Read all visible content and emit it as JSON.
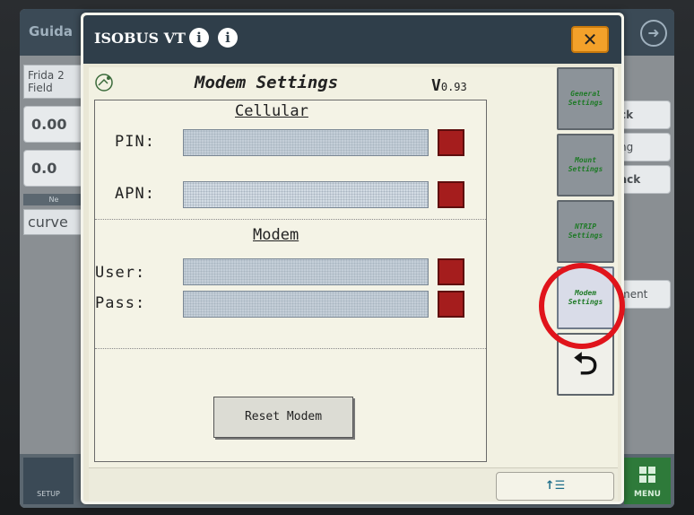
{
  "background": {
    "title": "Guida",
    "left_cards": [
      "Frida 2",
      "Field"
    ],
    "left_values": [
      "0.00",
      "0.0"
    ],
    "left_label": "Ne",
    "curve_text": "curve",
    "right_texts": [
      "ck",
      "ng",
      "ack",
      "ment"
    ],
    "setup_label": "SETUP",
    "menu_label": "MENU"
  },
  "vt": {
    "title": "ISOBUS VT",
    "info_icon_1": "i",
    "info_icon_2": "i",
    "close_label": "✕"
  },
  "mask": {
    "title": "Modem Settings",
    "version_big": "V",
    "version_small": "0.93",
    "cellular_title": "Cellular",
    "modem_title": "Modem",
    "fields": {
      "pin_label": "PIN:",
      "apn_label": "APN:",
      "user_label": "User:",
      "pass_label": "Pass:"
    },
    "reset_button": "Reset Modem"
  },
  "softkeys": [
    {
      "label": "General Settings",
      "selected": false
    },
    {
      "label": "Mount Settings",
      "selected": false
    },
    {
      "label": "NTRIP Settings",
      "selected": false
    },
    {
      "label": "Modem Settings",
      "selected": true
    }
  ],
  "back_key": "⮌",
  "bottom_nav": "↑☰",
  "colors": {
    "highlight_ring": "#e0141b",
    "status_box": "#a51d1d",
    "close_button": "#f3a12a",
    "softkey_text": "#1e7a26"
  }
}
